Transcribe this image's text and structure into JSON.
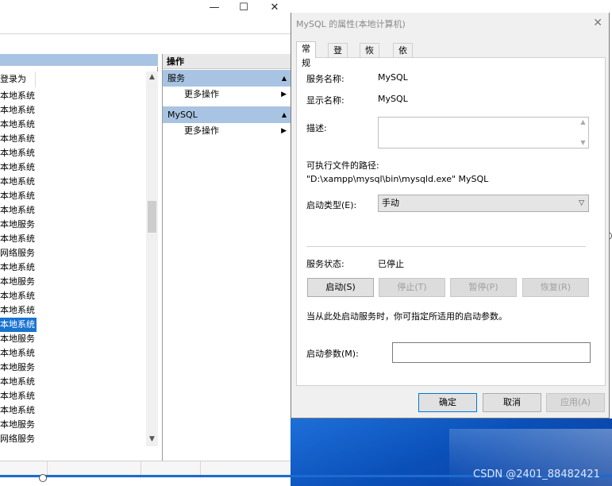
{
  "services_window": {
    "caption_buttons": {
      "minimize": "—",
      "maximize": "☐",
      "close": "✕"
    },
    "list": {
      "column_header": "登录为",
      "rows": [
        "本地系统",
        "本地系统",
        "本地系统",
        "本地系统",
        "本地系统",
        "本地系统",
        "本地系统",
        "本地系统",
        "本地系统",
        "本地服务",
        "本地系统",
        "网络服务",
        "本地系统",
        "本地服务",
        "本地系统",
        "本地系统",
        "本地系统",
        "本地服务",
        "本地系统",
        "本地服务",
        "本地系统",
        "本地系统",
        "本地系统",
        "本地服务",
        "网络服务"
      ],
      "selected_index": 16,
      "scroll_up": "▲",
      "scroll_down": "▼"
    },
    "actions": {
      "title": "操作",
      "groups": [
        {
          "label": "服务",
          "item": "更多操作"
        },
        {
          "label": "MySQL",
          "item": "更多操作"
        }
      ]
    }
  },
  "dialog": {
    "title": "MySQL 的属性(本地计算机)",
    "close": "✕",
    "tabs": [
      "常规",
      "登录",
      "恢复",
      "依存关系"
    ],
    "active_tab": 0,
    "service_name_label": "服务名称:",
    "service_name": "MySQL",
    "display_name_label": "显示名称:",
    "display_name": "MySQL",
    "description_label": "描述:",
    "description": "",
    "exe_path_label": "可执行文件的路径:",
    "exe_path": "\"D:\\xampp\\mysql\\bin\\mysqld.exe\" MySQL",
    "startup_type_label": "启动类型(E):",
    "startup_type": "手动",
    "service_status_label": "服务状态:",
    "service_status": "已停止",
    "buttons": {
      "start": "启动(S)",
      "stop": "停止(T)",
      "pause": "暂停(P)",
      "resume": "恢复(R)"
    },
    "hint": "当从此处启动服务时，你可指定所适用的启动参数。",
    "start_params_label": "启动参数(M):",
    "start_params_value": "",
    "footer": {
      "ok": "确定",
      "cancel": "取消",
      "apply": "应用(A)"
    }
  },
  "watermark": "CSDN @2401_88482421",
  "colors": {
    "selection": "#1a73d0",
    "group_header": "#a9c4e2",
    "desktop_blue": "#0a4fb8"
  }
}
